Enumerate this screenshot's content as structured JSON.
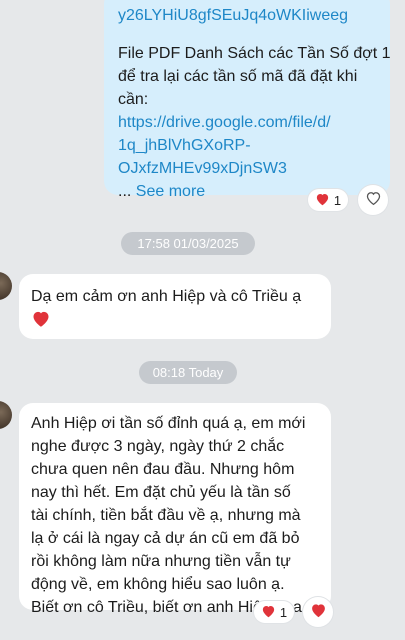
{
  "outgoing_message": {
    "link_tail": "y26LYHiU8gfSEuJq4oWKIiweeg",
    "lines": [
      "File PDF Danh Sách các Tần Số đợt 1",
      "để tra lại các tần số mã đã đặt khi",
      "cần:"
    ],
    "drive_link_lines": [
      "https://drive.google.com/file/d/",
      "1q_jhBlVhGXoRP-",
      "OJxfzMHEv99xDjnSW3"
    ],
    "ellipsis": "...",
    "see_more": "See more",
    "reaction_count": "1"
  },
  "timestamp_1": "17:58 01/03/2025",
  "incoming_message_1": {
    "text": "Dạ em cảm ơn anh Hiệp và cô Triều ạ"
  },
  "timestamp_2": "08:18 Today",
  "incoming_message_2": {
    "lines": [
      "Anh Hiệp ơi tần số đỉnh quá ạ, em mới",
      "nghe được 3 ngày, ngày thứ 2 chắc",
      "chưa quen nên đau đầu. Nhưng hôm",
      "nay thì hết. Em đặt chủ yếu là tần số",
      "tài chính, tiền bắt đầu về ạ, nhưng mà",
      "lạ ở cái là ngay cả dự án cũ em đã bỏ",
      "rồi không làm nữa nhưng tiền vẫn tự",
      "động về, em không hiểu sao luôn ạ.",
      "Biết ơn cô Triều, biết ơn anh Hiệp ạaa"
    ],
    "reaction_count": "1"
  },
  "colors": {
    "background": "#e6e8ea",
    "outgoing_bubble": "#d6eefc",
    "link": "#1e87c7",
    "heart": "#e0333a",
    "timestamp_pill": "#c5c9ce"
  },
  "icons": [
    "heart-icon",
    "heart-outline-icon",
    "avatar"
  ]
}
